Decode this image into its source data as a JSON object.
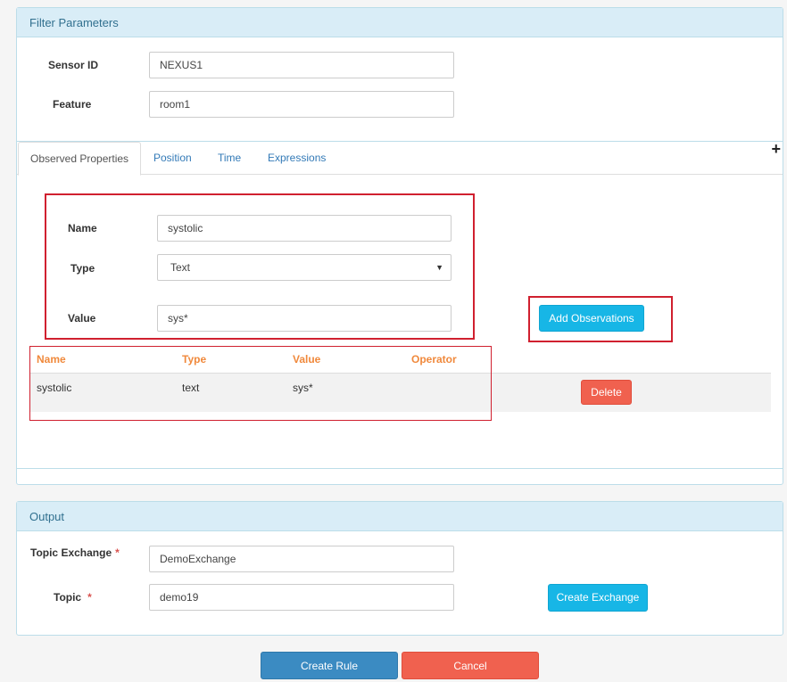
{
  "filter": {
    "heading": "Filter Parameters",
    "sensor_id_label": "Sensor ID",
    "sensor_id_value": "NEXUS1",
    "feature_label": "Feature",
    "feature_value": "room1",
    "tabs": [
      {
        "label": "Observed Properties",
        "active": true
      },
      {
        "label": "Position"
      },
      {
        "label": "Time"
      },
      {
        "label": "Expressions"
      }
    ],
    "add_tab_icon": "+",
    "observed": {
      "name_label": "Name",
      "name_value": "systolic",
      "type_label": "Type",
      "type_value": "Text",
      "value_label": "Value",
      "value_value": "sys*",
      "add_button": "Add Observations"
    },
    "table": {
      "headers": [
        "Name",
        "Type",
        "Value",
        "Operator"
      ],
      "rows": [
        {
          "name": "systolic",
          "type": "text",
          "value": "sys*",
          "operator": "",
          "action": "Delete"
        }
      ]
    }
  },
  "output": {
    "heading": "Output",
    "topic_exchange_label": "Topic Exchange",
    "topic_exchange_value": "DemoExchange",
    "topic_label": "Topic",
    "topic_value": "demo19",
    "required_mark": "*",
    "create_exchange_button": "Create Exchange"
  },
  "footer": {
    "create_rule_button": "Create Rule",
    "cancel_button": "Cancel"
  },
  "colors": {
    "heading_bg": "#d9edf7",
    "heading_text": "#31708f",
    "info": "#17b6e6",
    "danger": "#f0614f",
    "primary": "#3b8bc2",
    "table_header": "#f0893c",
    "highlight_box": "#d0202f"
  }
}
